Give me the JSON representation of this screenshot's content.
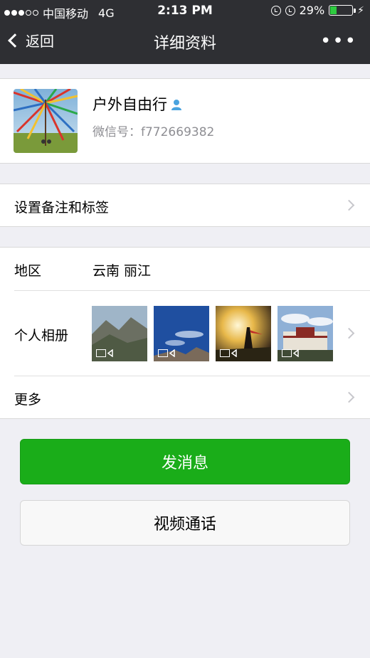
{
  "status_bar": {
    "carrier": "中国移动",
    "network": "4G",
    "time": "2:13 PM",
    "battery_percent_label": "29%",
    "battery_level": 0.29,
    "signal_strength": 3
  },
  "nav": {
    "back_label": "返回",
    "title": "详细资料",
    "more_label": "•••"
  },
  "profile": {
    "name": "户外自由行",
    "wechat_id": "微信号：f772669382"
  },
  "remark_row": {
    "label": "设置备注和标签"
  },
  "region_row": {
    "label": "地区",
    "value": "云南  丽江"
  },
  "album_row": {
    "label": "个人相册",
    "photos": [
      {
        "name": "mountain-photo",
        "type": "video"
      },
      {
        "name": "sky-photo",
        "type": "video"
      },
      {
        "name": "sunset-photo",
        "type": "video"
      },
      {
        "name": "palace-photo",
        "type": "video"
      }
    ]
  },
  "more_row": {
    "label": "更多"
  },
  "buttons": {
    "send_message": "发消息",
    "video_call": "视频通话"
  },
  "colors": {
    "nav_bg": "#2e2f33",
    "primary_green": "#1aad19",
    "page_bg": "#efeff4"
  }
}
